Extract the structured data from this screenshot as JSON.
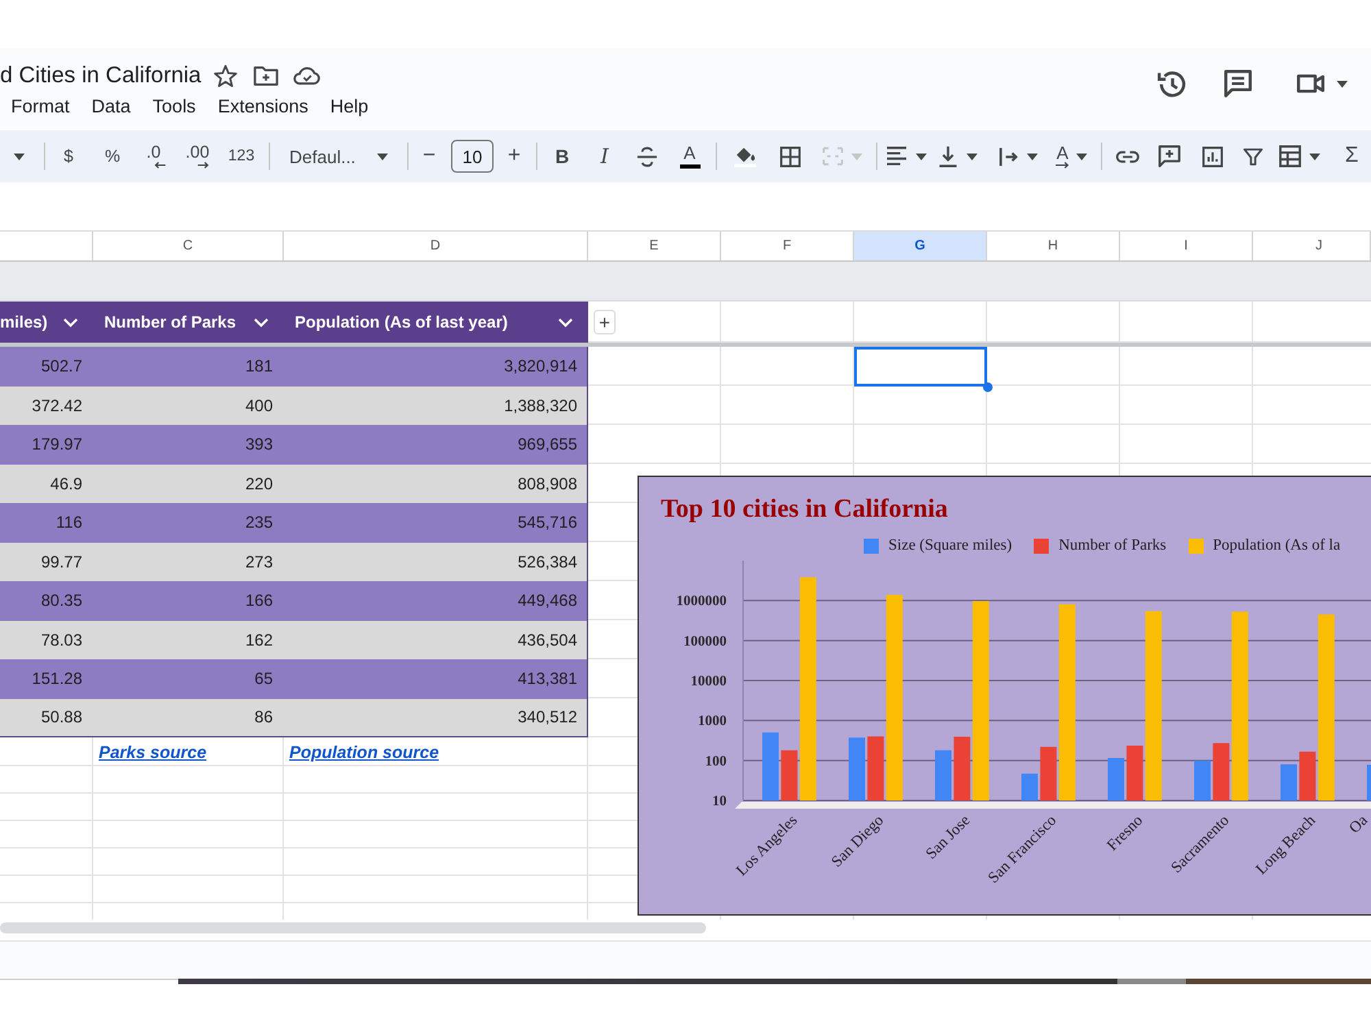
{
  "document": {
    "title": "d Cities in California"
  },
  "menu": [
    "Format",
    "Data",
    "Tools",
    "Extensions",
    "Help"
  ],
  "toolbar": {
    "currency": "$",
    "percent": "%",
    "decrease_decimals": ".0",
    "increase_decimals": ".00",
    "number_format": "123",
    "font": "Defaul...",
    "size_decrease": "−",
    "font_size": "10",
    "size_increase": "+",
    "bold": "B",
    "italic": "I",
    "text_color": "A",
    "merge": {
      "disabled": true
    },
    "text_rotation": "A",
    "functions": "Σ"
  },
  "column_headers": [
    {
      "label": "C",
      "selected": false
    },
    {
      "label": "D",
      "selected": false
    },
    {
      "label": "E",
      "selected": false
    },
    {
      "label": "F",
      "selected": false
    },
    {
      "label": "G",
      "selected": true
    },
    {
      "label": "H",
      "selected": false
    },
    {
      "label": "I",
      "selected": false
    },
    {
      "label": "J",
      "selected": false
    }
  ],
  "table": {
    "columns": [
      "miles)",
      "Number of Parks",
      "Population (As of last year)"
    ],
    "add_column": "+",
    "rows": [
      {
        "cells": [
          "502.7",
          "181",
          "3,820,914"
        ],
        "active_cell": true
      },
      {
        "cells": [
          "372.42",
          "400",
          "1,388,320"
        ],
        "active_cell": false
      },
      {
        "cells": [
          "179.97",
          "393",
          "969,655"
        ],
        "active_cell": false
      },
      {
        "cells": [
          "46.9",
          "220",
          "808,908"
        ],
        "active_cell": false
      },
      {
        "cells": [
          "116",
          "235",
          "545,716"
        ],
        "active_cell": false
      },
      {
        "cells": [
          "99.77",
          "273",
          "526,384"
        ],
        "active_cell": false
      },
      {
        "cells": [
          "80.35",
          "166",
          "449,468"
        ],
        "active_cell": false
      },
      {
        "cells": [
          "78.03",
          "162",
          "436,504"
        ],
        "active_cell": false
      },
      {
        "cells": [
          "151.28",
          "65",
          "413,381"
        ],
        "active_cell": false
      },
      {
        "cells": [
          "50.88",
          "86",
          "340,512"
        ],
        "active_cell": false
      }
    ],
    "links": [
      "Parks source",
      "Population source"
    ]
  },
  "chart": {
    "chart_data": {
      "type": "bar",
      "title": "Top 10 cities in California",
      "categories": [
        "Los Angeles",
        "San Diego",
        "San Jose",
        "San Francisco",
        "Fresno",
        "Sacramento",
        "Long Beach",
        "Oa"
      ],
      "series": [
        {
          "name": "Size (Square miles)",
          "color": "#4285f4",
          "values": [
            502.7,
            372.42,
            179.97,
            46.9,
            116,
            99.77,
            80.35,
            78.03
          ]
        },
        {
          "name": "Number of Parks",
          "color": "#ea4335",
          "values": [
            181,
            400,
            393,
            220,
            235,
            273,
            166,
            null
          ]
        },
        {
          "name": "Population (As of la",
          "color": "#fbbc04",
          "values": [
            3820914,
            1388320,
            969655,
            808908,
            545716,
            526384,
            449468,
            null
          ]
        }
      ],
      "log": true,
      "ylim": [
        10,
        10000000
      ],
      "yticks": [
        10,
        100,
        1000,
        10000,
        100000,
        1000000
      ],
      "grid": true,
      "legend": "top"
    }
  }
}
